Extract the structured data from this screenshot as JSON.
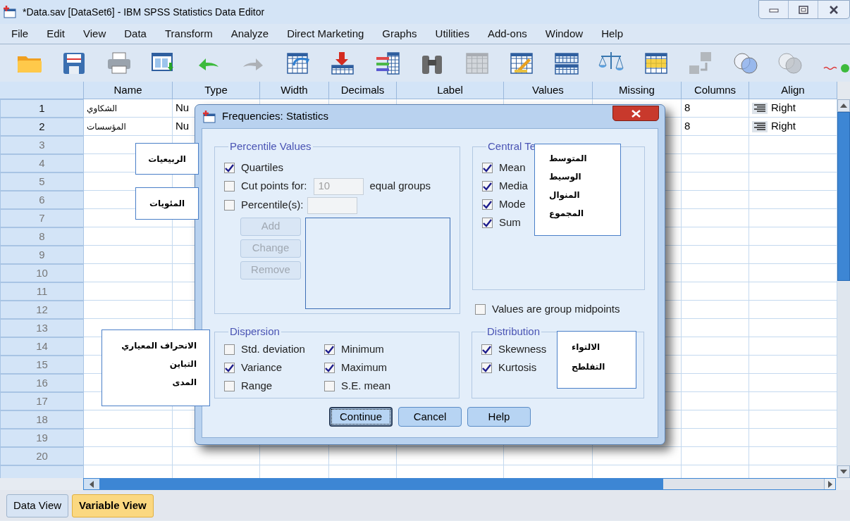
{
  "window": {
    "title": "*Data.sav [DataSet6] - IBM SPSS Statistics Data Editor"
  },
  "menu": [
    "File",
    "Edit",
    "View",
    "Data",
    "Transform",
    "Analyze",
    "Direct Marketing",
    "Graphs",
    "Utilities",
    "Add-ons",
    "Window",
    "Help"
  ],
  "toolbar": [
    {
      "kind": "folder",
      "disabled": false
    },
    {
      "kind": "floppy",
      "disabled": false
    },
    {
      "kind": "printer",
      "disabled": false
    },
    {
      "kind": "window",
      "disabled": false
    },
    {
      "kind": "undo",
      "disabled": false
    },
    {
      "kind": "redo",
      "disabled": true
    },
    {
      "kind": "table-arrow",
      "disabled": false
    },
    {
      "kind": "down-table",
      "disabled": false
    },
    {
      "kind": "list-table",
      "disabled": false
    },
    {
      "kind": "binoculars",
      "disabled": false
    },
    {
      "kind": "grid",
      "disabled": true
    },
    {
      "kind": "table-pencil",
      "disabled": false
    },
    {
      "kind": "split-table",
      "disabled": false
    },
    {
      "kind": "scales",
      "disabled": false
    },
    {
      "kind": "highlight-table",
      "disabled": false
    },
    {
      "kind": "squares-arrow",
      "disabled": true
    },
    {
      "kind": "circles",
      "disabled": false
    },
    {
      "kind": "circles",
      "disabled": true
    },
    {
      "kind": "spell",
      "disabled": false
    }
  ],
  "table": {
    "columns": [
      "Name",
      "Type",
      "Width",
      "Decimals",
      "Label",
      "Values",
      "Missing",
      "Columns",
      "Align"
    ],
    "rows": [
      {
        "number": "1",
        "name": "الشكاوي",
        "type": "Nu",
        "columns": "8",
        "align": "Right"
      },
      {
        "number": "2",
        "name": "المؤسسات",
        "type": "Nu",
        "columns": "8",
        "align": "Right"
      },
      {
        "number": "3"
      },
      {
        "number": "4"
      },
      {
        "number": "5"
      },
      {
        "number": "6"
      },
      {
        "number": "7"
      },
      {
        "number": "8"
      },
      {
        "number": "9"
      },
      {
        "number": "10"
      },
      {
        "number": "11"
      },
      {
        "number": "12"
      },
      {
        "number": "13"
      },
      {
        "number": "14"
      },
      {
        "number": "15"
      },
      {
        "number": "16"
      },
      {
        "number": "17"
      },
      {
        "number": "18"
      },
      {
        "number": "19"
      },
      {
        "number": "20"
      }
    ]
  },
  "tabs": [
    {
      "label": "Data View",
      "selected": false
    },
    {
      "label": "Variable View",
      "selected": true
    }
  ],
  "dialog": {
    "title": "Frequencies: Statistics",
    "percentile_values": {
      "title": "Percentile Values",
      "quartiles": {
        "label": "Quartiles",
        "checked": true
      },
      "cut_points": {
        "label": "Cut points for:",
        "checked": false,
        "value": "10",
        "suffix": "equal groups"
      },
      "percentiles": {
        "label": "Percentile(s):",
        "checked": false
      },
      "buttons": [
        {
          "label": "Add",
          "disabled": true
        },
        {
          "label": "Change",
          "disabled": true
        },
        {
          "label": "Remove",
          "disabled": true
        }
      ]
    },
    "central_tendency": {
      "title": "Central Te",
      "items": [
        {
          "label": "Mean",
          "checked": true
        },
        {
          "label": "Media",
          "checked": true
        },
        {
          "label": "Mode",
          "checked": true
        },
        {
          "label": "Sum",
          "checked": true
        }
      ]
    },
    "group_midpoints": {
      "label": "Values are group midpoints",
      "checked": false
    },
    "dispersion": {
      "title": "Dispersion",
      "items": [
        {
          "label": "Std. deviation",
          "checked": false
        },
        {
          "label": "Minimum",
          "checked": true
        },
        {
          "label": "Variance",
          "checked": true
        },
        {
          "label": "Maximum",
          "checked": true
        },
        {
          "label": "Range",
          "checked": false
        },
        {
          "label": "S.E. mean",
          "checked": false
        }
      ]
    },
    "distribution": {
      "title": "Distribution",
      "items": [
        {
          "label": "Skewness",
          "checked": true
        },
        {
          "label": "Kurtosis",
          "checked": true
        }
      ]
    },
    "buttons": [
      {
        "label": "Continue",
        "focused": true
      },
      {
        "label": "Cancel",
        "focused": false
      },
      {
        "label": "Help",
        "focused": false
      }
    ]
  },
  "callouts": [
    {
      "lines": [
        "الربيعيات"
      ]
    },
    {
      "lines": [
        "المئويات"
      ]
    },
    {
      "lines": [
        "المتوسط",
        "الوسيط",
        "المنوال",
        "المجموع"
      ]
    },
    {
      "lines": [
        "الالتواء",
        "التفلطح"
      ]
    },
    {
      "lines": [
        "الانحراف المعياري",
        "التباين",
        "المدى"
      ]
    }
  ]
}
